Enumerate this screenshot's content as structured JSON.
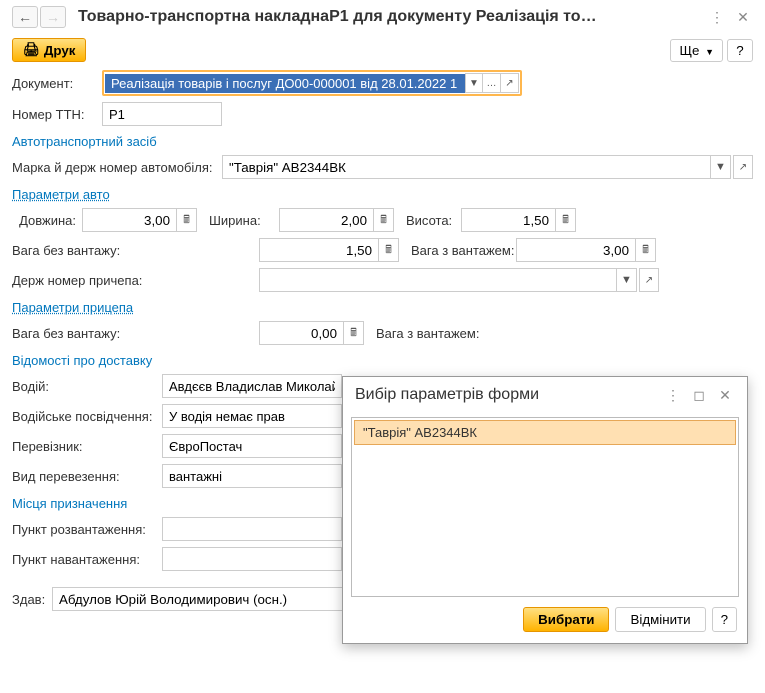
{
  "header": {
    "title": "Товарно-транспортна накладнаР1 для документу Реалізація то…"
  },
  "toolbar": {
    "print_label": "Друк",
    "print_icon": "🖨",
    "more_label": "Ще",
    "question": "?"
  },
  "form": {
    "doc_label": "Документ:",
    "doc_value": "Реалізація товарів і послуг ДО00-000001 від 28.01.2022 1",
    "ttn_label": "Номер ТТН:",
    "ttn_value": "Р1",
    "sections": {
      "auto": "Автотранспортний засіб",
      "auto_params": "Параметри авто",
      "trailer_params": "Параметри прицепа",
      "delivery_info": "Відомості про доставку",
      "destination": "Місця призначення"
    },
    "car_label": "Марка й держ номер автомобіля:",
    "car_value": "\"Таврія\" АВ2344ВК",
    "length_label": "Довжина:",
    "length_value": "3,00",
    "width_label": "Ширина:",
    "width_value": "2,00",
    "height_label": "Висота:",
    "height_value": "1,50",
    "weight_empty_label": "Вага без вантажу:",
    "weight_empty_value": "1,50",
    "weight_loaded_label": "Вага з вантажем:",
    "weight_loaded_value": "3,00",
    "trailer_label": "Держ номер причепа:",
    "trailer_value": "",
    "trailer_weight_empty_label": "Вага без вантажу:",
    "trailer_weight_empty_value": "0,00",
    "trailer_weight_loaded_label": "Вага з вантажем:",
    "driver_label": "Водій:",
    "driver_value": "Авдєєв Владислав Миколай",
    "license_label": "Водійське посвідчення:",
    "license_value": "У водія немає прав",
    "carrier_label": "Перевізник:",
    "carrier_value": "ЄвроПостач",
    "transport_type_label": "Вид перевезення:",
    "transport_type_value": "вантажні",
    "unload_label": "Пункт розвантаження:",
    "load_label": "Пункт навантаження:",
    "sender_label": "Здав:",
    "sender_value": "Абдулов Юрій Володимирович (осн.)"
  },
  "popup": {
    "title": "Вибір параметрів форми",
    "item": "\"Таврія\" АВ2344ВК",
    "select_label": "Вибрати",
    "cancel_label": "Відмінити",
    "question": "?"
  }
}
